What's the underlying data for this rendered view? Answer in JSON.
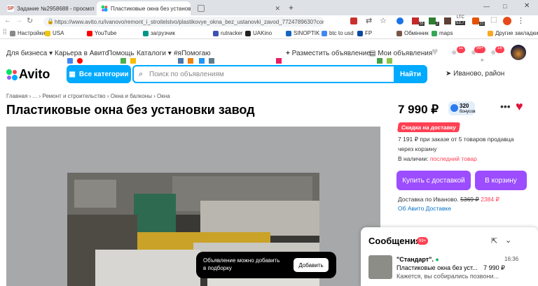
{
  "browser": {
    "tabs": [
      {
        "icon": "SP",
        "title": "Задание №2958688 - просмотр з"
      },
      {
        "icon": "avito",
        "title": "Пластиковые окна без установки"
      },
      {
        "icon": "page",
        "title": ""
      }
    ],
    "url": "https://www.avito.ru/ivanovo/remont_i_stroitelstvo/plastikovye_okna_bez_ustanovki_zavod_7724789630?context=H4sIAAAAA...",
    "ext_badges": {
      "a": "55",
      "b": "2",
      "ltc": "LTC",
      "ltc_val": "53.7",
      "c": "21"
    },
    "bookmarks": [
      "Настройки",
      "USA",
      "YouTube",
      "загрузчик",
      "rutracker",
      "UAKino",
      "SINOPTIK",
      "btc to usd",
      "FP",
      "Обмінник",
      "maps"
    ],
    "bookmarks_more": "Другие закладки"
  },
  "topnav": {
    "links": [
      "Для бизнеса",
      "Карьера в Авито",
      "Помощь",
      "Каталоги",
      "#яПомогаю"
    ],
    "post_ad": "Разместить объявление",
    "my_ads": "Мои объявления",
    "badges": {
      "favorites": "",
      "notifications": "11",
      "messages": "99+",
      "cart": "16"
    }
  },
  "header": {
    "logo": "Avito",
    "categories_button": "Все категории",
    "search_placeholder": "Поиск по объявлениям",
    "find_button": "Найти",
    "location": "Иваново, район"
  },
  "breadcrumb": "Главная › ... › Ремонт и строительство › Окна и балконы › Окна",
  "listing": {
    "title": "Пластиковые окна без установки завод",
    "price": "7 990 ₽",
    "bonus_value": "320",
    "bonus_label": "бонусов",
    "discount_tag": "Скидка на доставку",
    "bulk_price_line1": "7 191 ₽ при заказе от 5 товаров продавца",
    "bulk_price_line2": "через корзину",
    "stock_label": "В наличии:",
    "stock_value": "последний товар",
    "buy_button": "Купить с доставкой",
    "cart_button": "В корзину",
    "delivery_label": "Доставка по Иваново.",
    "delivery_old": "5369 ₽",
    "delivery_new": "2384 ₽",
    "delivery_link": "Об Авито Доставке"
  },
  "toast": {
    "text_line1": "Объявление можно добавить",
    "text_line2": "в подборку",
    "button": "Добавить"
  },
  "messages": {
    "title": "Сообщения",
    "badge": "99+",
    "sender": "\"Стандарт\".",
    "time": "16:36",
    "subject": "Пластиковые окна без уст...",
    "subject_price": "7 990 ₽",
    "preview": "Кажется, вы собирались позвони..."
  },
  "colors": {
    "avito_blue": "#00aaff",
    "purple": "#9b4dff",
    "red": "#ff4053"
  }
}
